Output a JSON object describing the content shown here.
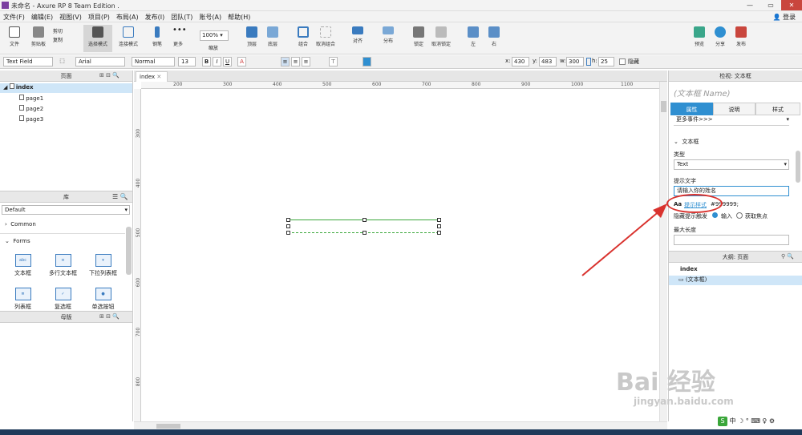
{
  "window": {
    "title": "未命名 - Axure RP 8 Team Edition ."
  },
  "menu": [
    "文件(F)",
    "编辑(E)",
    "视图(V)",
    "项目(P)",
    "布局(A)",
    "发布(I)",
    "团队(T)",
    "账号(A)",
    "帮助(H)"
  ],
  "login": "登录",
  "toolbar": {
    "file": "文件",
    "clipboard": "剪贴板",
    "cut": "剪切",
    "copy": "复制",
    "select": "选择模式",
    "connect": "连接模式",
    "pen": "钢笔",
    "more": "更多",
    "zoom_value": "100%",
    "zoom_label": "缩放",
    "top": "顶层",
    "bottom": "底层",
    "group": "组合",
    "ungroup": "取消组合",
    "align": "对齐",
    "distribute": "分布",
    "lock": "锁定",
    "unlock": "取消锁定",
    "left": "左",
    "right": "右",
    "preview": "预览",
    "share": "分享",
    "publish": "发布"
  },
  "format": {
    "widget_type": "Text Field",
    "font": "Arial",
    "style": "Normal",
    "size": "13",
    "x_label": "x:",
    "x": "430",
    "y_label": "y:",
    "y": "483",
    "w_label": "w:",
    "w": "300",
    "h_label": "h:",
    "h": "25",
    "hidden": "隐藏"
  },
  "pages_panel": {
    "title": "页面",
    "root": "index",
    "children": [
      "page1",
      "page2",
      "page3"
    ]
  },
  "library_panel": {
    "title": "库",
    "selected": "Default",
    "common": "Common",
    "forms": "Forms",
    "widgets": [
      "文本框",
      "多行文本框",
      "下拉列表框",
      "列表框",
      "复选框",
      "单选按钮"
    ],
    "widget_icons": [
      "abc",
      "≡",
      "▾",
      "≣",
      "✓",
      "●"
    ]
  },
  "masters_panel": {
    "title": "母版"
  },
  "canvas": {
    "tab": "index",
    "hruler": [
      "200",
      "300",
      "400",
      "500",
      "600",
      "700",
      "800",
      "900",
      "1000",
      "1100"
    ],
    "vruler": [
      "300",
      "400",
      "500",
      "600",
      "700",
      "800"
    ]
  },
  "inspector": {
    "header": "检视: 文本框",
    "name_placeholder": "(文本框 Name)",
    "tab_props": "属性",
    "tab_notes": "说明",
    "tab_style": "样式",
    "more_events": "更多事件>>>",
    "section": "文本框",
    "type_label": "类型",
    "type_value": "Text",
    "hint_label": "提示文字",
    "hint_value": "请输入你的姓名",
    "hint_style_icon": "Aa",
    "hint_style_link": "提示样式",
    "hint_color": "#999999;",
    "hide_hint_label": "隐藏提示触发",
    "opt_input": "输入",
    "opt_focus": "获取焦点",
    "maxlen_label": "最大长度"
  },
  "outline": {
    "title": "大纲: 页面",
    "root": "index",
    "child": "(文本框)"
  },
  "watermark": {
    "text": "Bai 经验",
    "url": "jingyan.baidu.com"
  },
  "colors": {
    "accent": "#2f8fd1",
    "selection": "#cfe6f8",
    "annotation": "#d9322e",
    "guide": "#3aa63a"
  }
}
